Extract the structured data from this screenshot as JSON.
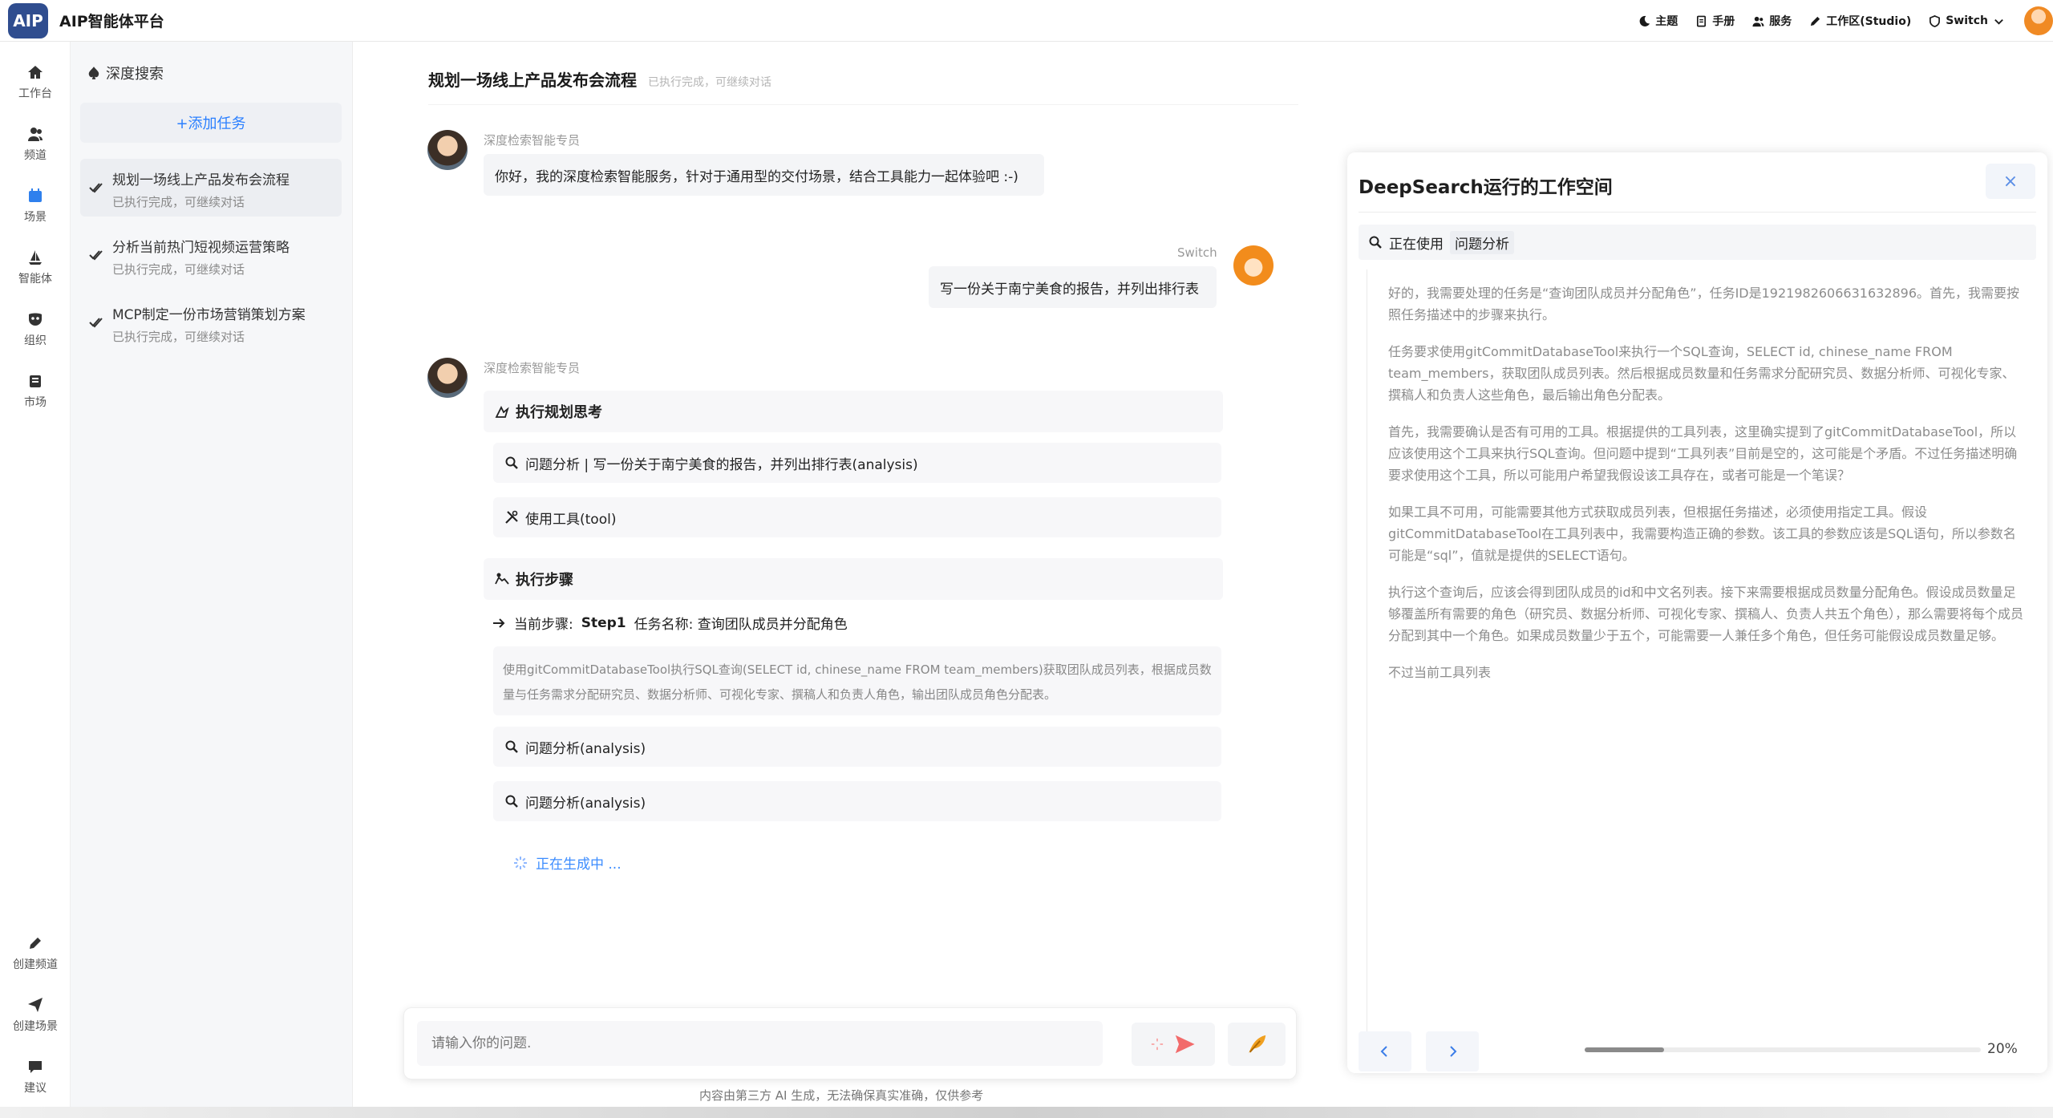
{
  "header": {
    "logo_text": "AIP",
    "title": "AIP智能体平台",
    "nav": [
      {
        "label": "主题",
        "icon": "moon-icon"
      },
      {
        "label": "手册",
        "icon": "book-icon"
      },
      {
        "label": "服务",
        "icon": "users-icon"
      },
      {
        "label": "工作区(Studio)",
        "icon": "pen-icon"
      },
      {
        "label": "Switch",
        "icon": "shield-icon"
      }
    ]
  },
  "rail": {
    "top": [
      {
        "label": "工作台",
        "icon": "home-icon"
      },
      {
        "label": "频道",
        "icon": "users-icon"
      },
      {
        "label": "场景",
        "icon": "calendar-icon"
      },
      {
        "label": "智能体",
        "icon": "sailboat-icon"
      },
      {
        "label": "组织",
        "icon": "mask-icon"
      },
      {
        "label": "市场",
        "icon": "store-icon"
      }
    ],
    "bottom": [
      {
        "label": "创建频道",
        "icon": "pencil-icon"
      },
      {
        "label": "创建场景",
        "icon": "send-icon"
      },
      {
        "label": "建议",
        "icon": "comment-icon"
      }
    ]
  },
  "tasks": {
    "title": "深度搜索",
    "add_label": "+添加任务",
    "items": [
      {
        "title": "规划一场线上产品发布会流程",
        "status": "已执行完成，可继续对话"
      },
      {
        "title": "分析当前热门短视频运营策略",
        "status": "已执行完成，可继续对话"
      },
      {
        "title": "MCP制定一份市场营销策划方案",
        "status": "已执行完成，可继续对话"
      }
    ]
  },
  "chat": {
    "title": "规划一场线上产品发布会流程",
    "subtitle": "已执行完成，可继续对话",
    "bot_name": "深度检索智能专员",
    "welcome": "你好，我的深度检索智能服务，针对于通用型的交付场景，结合工具能力一起体验吧 :-)",
    "user_name": "Switch",
    "user_message": "写一份关于南宁美食的报告，并列出排行表",
    "planning_title": "执行规划思考",
    "plan_items": [
      "问题分析 | 写一份关于南宁美食的报告，并列出排行表(analysis)",
      "使用工具(tool)"
    ],
    "steps_title": "执行步骤",
    "current_step_label": "当前步骤:",
    "current_step": "Step1",
    "task_name_label": "任务名称: 查询团队成员并分配角色",
    "step_description": "使用gitCommitDatabaseTool执行SQL查询(SELECT id, chinese_name FROM team_members)获取团队成员列表，根据成员数量与任务需求分配研究员、数据分析师、可视化专家、撰稿人和负责人角色，输出团队成员角色分配表。",
    "analysis_items": [
      "问题分析(analysis)",
      "问题分析(analysis)"
    ],
    "generating": "正在生成中 ..."
  },
  "input": {
    "placeholder": "请输入你的问题.",
    "disclaimer": "内容由第三方 AI 生成，无法确保真实准确，仅供参考"
  },
  "workspace": {
    "title": "DeepSearch运行的工作空间",
    "close": "×",
    "using_label": "正在使用",
    "using_tool": "问题分析",
    "paragraphs": [
      "好的，我需要处理的任务是“查询团队成员并分配角色”，任务ID是1921982606631632896。首先，我需要按照任务描述中的步骤来执行。",
      "任务要求使用gitCommitDatabaseTool来执行一个SQL查询，SELECT id, chinese_name FROM team_members，获取团队成员列表。然后根据成员数量和任务需求分配研究员、数据分析师、可视化专家、撰稿人和负责人这些角色，最后输出角色分配表。",
      "首先，我需要确认是否有可用的工具。根据提供的工具列表，这里确实提到了gitCommitDatabaseTool，所以应该使用这个工具来执行SQL查询。但问题中提到“工具列表”目前是空的，这可能是个矛盾。不过任务描述明确要求使用这个工具，所以可能用户希望我假设该工具存在，或者可能是一个笔误？",
      "如果工具不可用，可能需要其他方式获取成员列表，但根据任务描述，必须使用指定工具。假设gitCommitDatabaseTool在工具列表中，我需要构造正确的参数。该工具的参数应该是SQL语句，所以参数名可能是“sql”，值就是提供的SELECT语句。",
      "执行这个查询后，应该会得到团队成员的id和中文名列表。接下来需要根据成员数量分配角色。假设成员数量足够覆盖所有需要的角色（研究员、数据分析师、可视化专家、撰稿人、负责人共五个角色），那么需要将每个成员分配到其中一个角色。如果成员数量少于五个，可能需要一人兼任多个角色，但任务可能假设成员数量足够。",
      "不过当前工具列表"
    ],
    "progress": 0.2,
    "progress_label": "20%"
  }
}
